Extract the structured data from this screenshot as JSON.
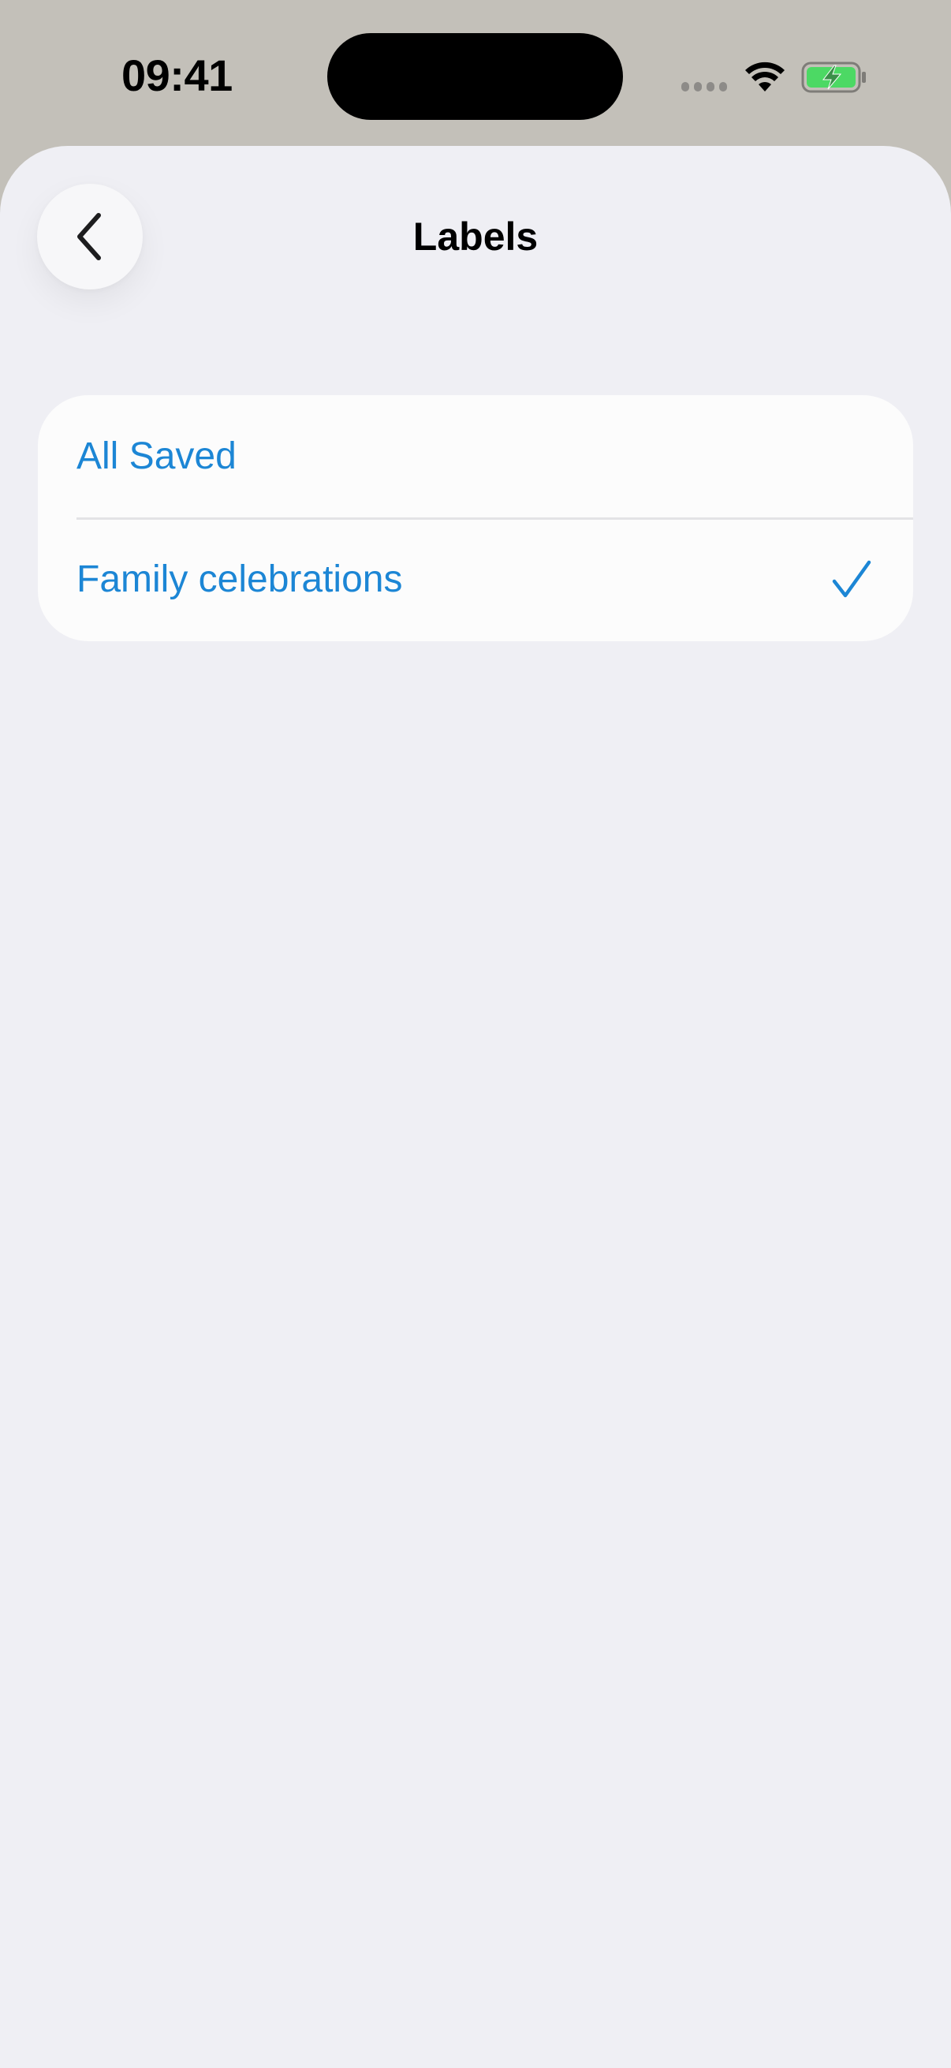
{
  "status_bar": {
    "time": "09:41",
    "icons": [
      "signal-dots-icon",
      "wifi-icon",
      "battery-charging-icon"
    ]
  },
  "header": {
    "title": "Labels",
    "back_icon": "chevron-left-icon"
  },
  "labels_list": {
    "items": [
      {
        "label": "All Saved",
        "selected": false
      },
      {
        "label": "Family celebrations",
        "selected": true
      }
    ],
    "selected_icon": "checkmark-icon"
  },
  "colors": {
    "accent": "#1c86d5",
    "sheet_background": "#efeff4",
    "status_bar_background": "#c3c0b9",
    "battery_fill": "#4cd964"
  }
}
